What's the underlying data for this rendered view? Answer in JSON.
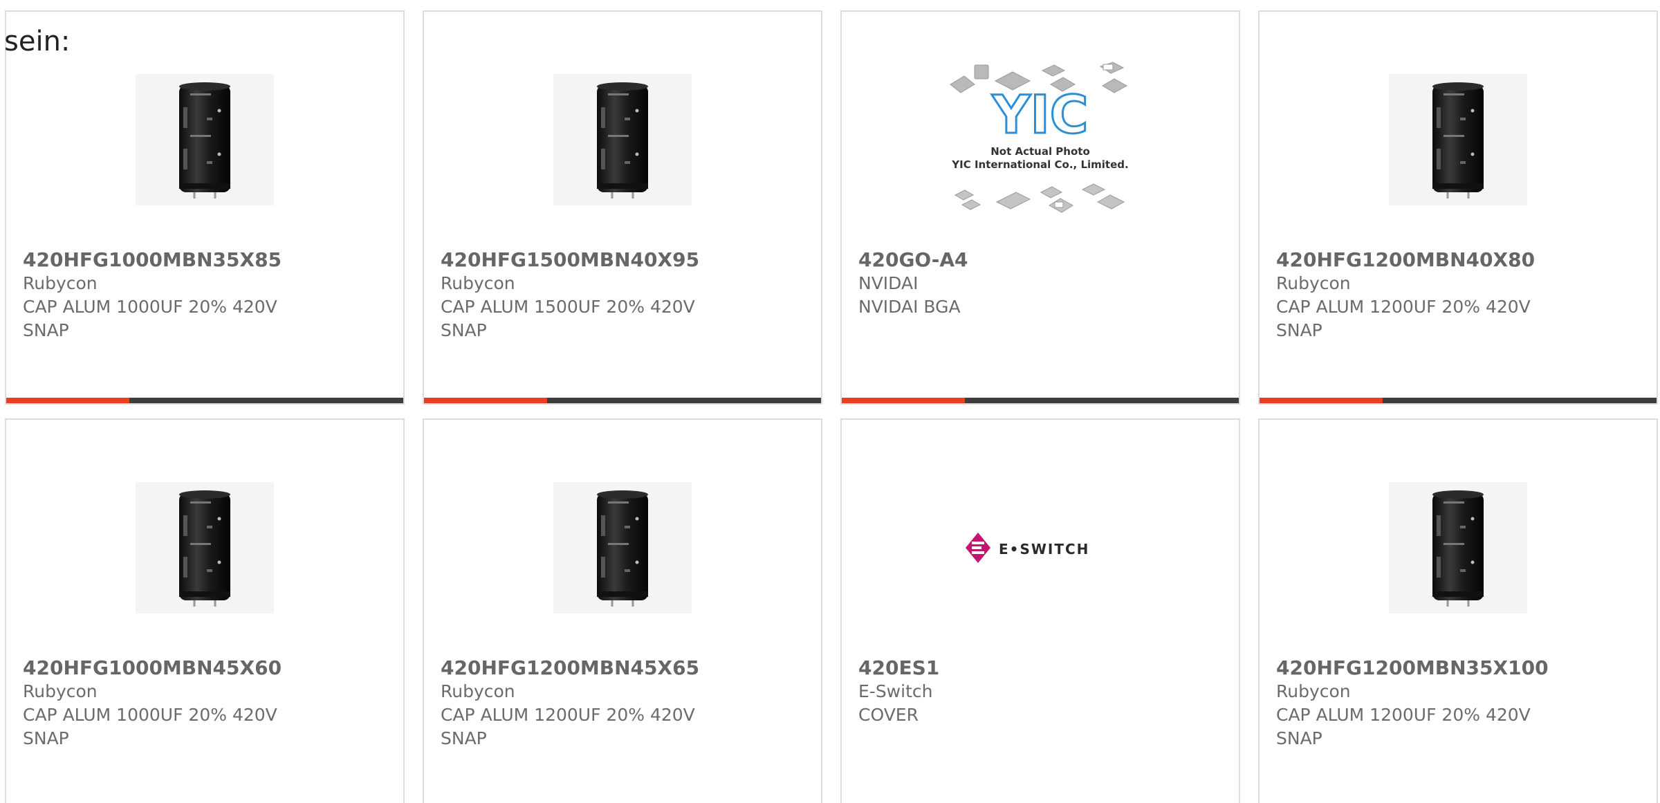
{
  "page": {
    "intro_text": "sein:"
  },
  "colors": {
    "accent": "#e8401c",
    "bar_dark": "#3d3d3d",
    "text_gray": "#6b6b6b",
    "border": "#dcdcdc",
    "eswitch_magenta": "#c4166f",
    "yic_blue": "#2a8fd6"
  },
  "products": [
    {
      "part_number": "420HFG1000MBN35X85",
      "manufacturer": "Rubycon",
      "description": "CAP ALUM 1000UF 20% 420V SNAP",
      "image": "capacitor-photo",
      "progress": 0.31
    },
    {
      "part_number": "420HFG1500MBN40X95",
      "manufacturer": "Rubycon",
      "description": "CAP ALUM 1500UF 20% 420V SNAP",
      "image": "capacitor-photo",
      "progress": 0.31
    },
    {
      "part_number": "420GO-A4",
      "manufacturer": "NVIDAI",
      "description": "NVIDAI BGA",
      "image": "yic-placeholder",
      "image_caption_1": "Not Actual Photo",
      "image_caption_2": "YIC International Co., Limited.",
      "image_logo_text": "YIC",
      "progress": 0.31
    },
    {
      "part_number": "420HFG1200MBN40X80",
      "manufacturer": "Rubycon",
      "description": "CAP ALUM 1200UF 20% 420V SNAP",
      "image": "capacitor-photo",
      "progress": 0.31
    },
    {
      "part_number": "420HFG1000MBN45X60",
      "manufacturer": "Rubycon",
      "description": "CAP ALUM 1000UF 20% 420V SNAP",
      "image": "capacitor-photo"
    },
    {
      "part_number": "420HFG1200MBN45X65",
      "manufacturer": "Rubycon",
      "description": "CAP ALUM 1200UF 20% 420V SNAP",
      "image": "capacitor-photo"
    },
    {
      "part_number": "420ES1",
      "manufacturer": "E-Switch",
      "description": "COVER",
      "image": "eswitch-logo",
      "image_logo_text": "E•SWITCH"
    },
    {
      "part_number": "420HFG1200MBN35X100",
      "manufacturer": "Rubycon",
      "description": "CAP ALUM 1200UF 20% 420V SNAP",
      "image": "capacitor-photo"
    }
  ]
}
